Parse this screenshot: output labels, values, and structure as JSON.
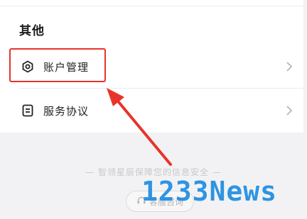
{
  "section": {
    "title": "其他"
  },
  "items": [
    {
      "label": "账户管理",
      "icon": "hexagon-settings-icon"
    },
    {
      "label": "服务协议",
      "icon": "document-icon"
    }
  ],
  "footer": {
    "note": "— 智领星辰保障您的信息安全 —",
    "support_label": "客服咨询",
    "support_icon": "headset-icon"
  },
  "watermark": {
    "text": "1233News"
  },
  "colors": {
    "highlight": "#e8332b",
    "watermark": "#1e8de2"
  }
}
